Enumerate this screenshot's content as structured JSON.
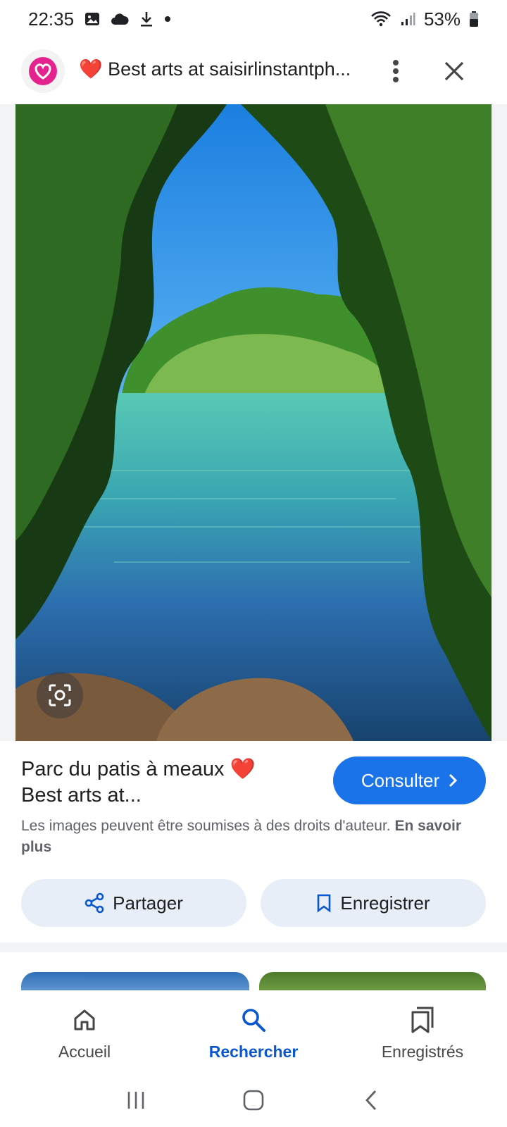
{
  "status_bar": {
    "time": "22:35",
    "battery": "53%",
    "icons": [
      "gallery-icon",
      "cloud-icon",
      "download-icon",
      "dot-icon",
      "wifi-icon",
      "signal-icon",
      "battery-icon"
    ]
  },
  "header": {
    "title": "Best arts at saisirlinstantph...",
    "heart_emoji": "❤️",
    "avatar_icon": "heart-logo-icon"
  },
  "image": {
    "description_icon": "lens-icon"
  },
  "result": {
    "title_line1": "Parc du patis à meaux ❤️",
    "title_line2": "Best arts at...",
    "consult_label": "Consulter",
    "copyright_text": "Les images peuvent être soumises à des droits d'auteur.",
    "learn_more": "En savoir plus"
  },
  "actions": {
    "share_label": "Partager",
    "save_label": "Enregistrer"
  },
  "bottom_nav": {
    "items": [
      {
        "label": "Accueil",
        "icon": "home-icon"
      },
      {
        "label": "Rechercher",
        "icon": "search-icon"
      },
      {
        "label": "Enregistrés",
        "icon": "saved-icon"
      }
    ],
    "active": "Rechercher"
  },
  "colors": {
    "accent": "#1a73e8",
    "active_nav": "#0b57d0",
    "chip_bg": "#e8eef8"
  }
}
